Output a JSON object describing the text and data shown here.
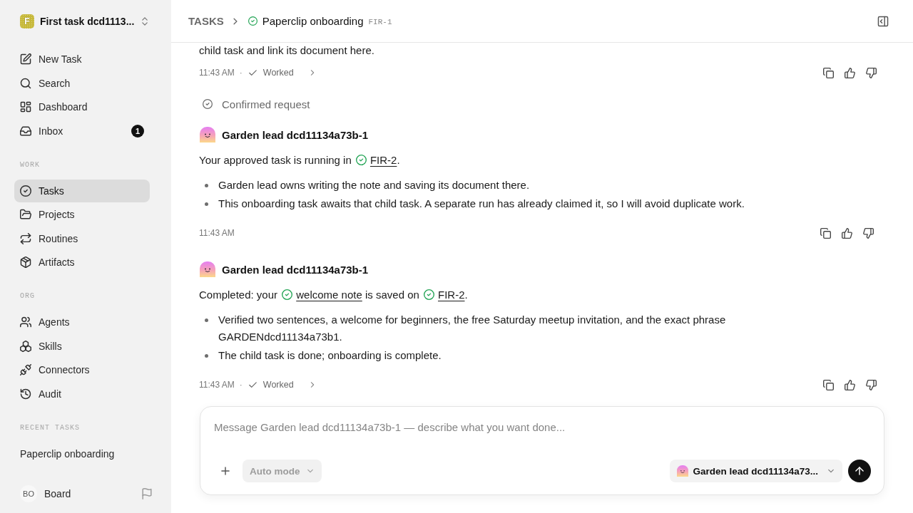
{
  "sidebar": {
    "workspace": {
      "logo": "F",
      "name": "First task dcd1113..."
    },
    "nav": [
      {
        "label": "New Task",
        "selected": false
      },
      {
        "label": "Search",
        "selected": false
      },
      {
        "label": "Dashboard",
        "selected": false
      },
      {
        "label": "Inbox",
        "selected": false,
        "badge": "1"
      }
    ],
    "sections": [
      {
        "heading": "WORK",
        "items": [
          {
            "label": "Tasks",
            "selected": true
          },
          {
            "label": "Projects",
            "selected": false
          },
          {
            "label": "Routines",
            "selected": false
          },
          {
            "label": "Artifacts",
            "selected": false
          }
        ]
      },
      {
        "heading": "ORG",
        "items": [
          {
            "label": "Agents",
            "selected": false
          },
          {
            "label": "Skills",
            "selected": false
          },
          {
            "label": "Connectors",
            "selected": false
          },
          {
            "label": "Audit",
            "selected": false
          }
        ]
      }
    ],
    "recent_tasks": {
      "heading": "RECENT TASKS",
      "items": [
        {
          "label": "Paperclip onboarding",
          "selected": false
        }
      ]
    },
    "user": {
      "initials": "BO",
      "name": "Board"
    }
  },
  "header": {
    "breadcrumb": "TASKS",
    "task": {
      "title": "Paperclip onboarding",
      "id": "FIR-1",
      "done": true
    }
  },
  "thread": [
    {
      "kind": "message",
      "paragraph": [
        {
          "kind": "text",
          "text": "child task and link its document here."
        }
      ],
      "meta": {
        "time": "11:43 AM",
        "separator": "·",
        "status": "Worked"
      }
    },
    {
      "kind": "event",
      "text": "Confirmed request"
    },
    {
      "kind": "message",
      "author": "Garden lead dcd11134a73b-1",
      "paragraph": [
        {
          "kind": "text",
          "text": "Your approved task is running in "
        },
        {
          "kind": "link",
          "text": "FIR-2",
          "done": true
        },
        {
          "kind": "text",
          "text": "."
        }
      ],
      "bullets": [
        "Garden lead owns writing the note and saving its document there.",
        "This onboarding task awaits that child task. A separate run has already claimed it, so I will avoid duplicate work."
      ],
      "meta": {
        "time": "11:43 AM"
      }
    },
    {
      "kind": "message",
      "author": "Garden lead dcd11134a73b-1",
      "paragraph": [
        {
          "kind": "text",
          "text": "Completed: your "
        },
        {
          "kind": "link",
          "text": "welcome note",
          "done": true
        },
        {
          "kind": "text",
          "text": " is saved on "
        },
        {
          "kind": "link",
          "text": "FIR-2",
          "done": true
        },
        {
          "kind": "text",
          "text": "."
        }
      ],
      "bullets": [
        "Verified two sentences, a welcome for beginners, the free Saturday meetup invitation, and the exact phrase GARDENdcd11134a73b1.",
        "The child task is done; onboarding is complete."
      ],
      "meta": {
        "time": "11:43 AM",
        "separator": "·",
        "status": "Worked"
      }
    }
  ],
  "composer": {
    "placeholder": "Message Garden lead dcd11134a73b-1 — describe what you want done...",
    "mode": {
      "label": "Auto mode",
      "disabled": true
    },
    "agent": {
      "label": "Garden lead dcd11134a73..."
    }
  }
}
